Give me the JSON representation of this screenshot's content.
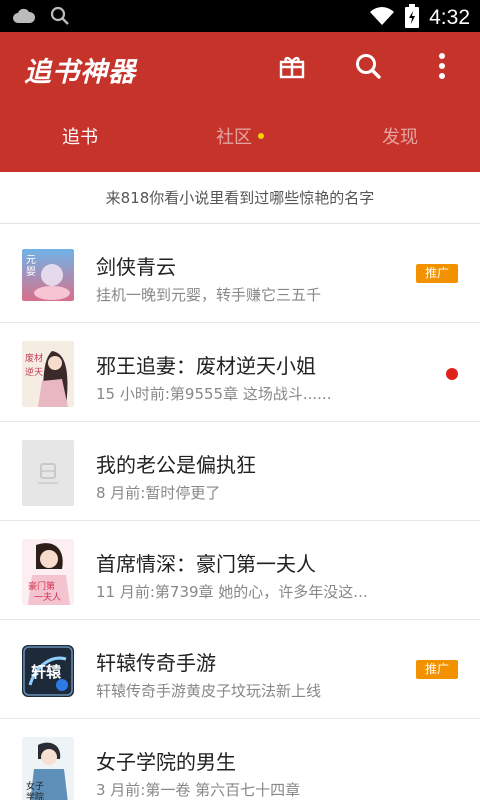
{
  "status_bar": {
    "time": "4:32",
    "icons": [
      "cloud-icon",
      "search-icon",
      "wifi-icon",
      "battery-icon"
    ]
  },
  "header": {
    "app_title": "追书神器",
    "icons": [
      "gift-icon",
      "search-icon",
      "more-vert-icon"
    ],
    "tabs": [
      {
        "label": "追书",
        "active": true
      },
      {
        "label": "社区",
        "active": false,
        "has_dot": true
      },
      {
        "label": "发现",
        "active": false
      }
    ],
    "accent_color": "#c5332b"
  },
  "notice": {
    "text": "来818你看小说里看到过哪些惊艳的名字"
  },
  "books": [
    {
      "title": "剑侠青云",
      "subtitle": "挂机一晚到元婴，转手赚它三五千",
      "badge": "推广",
      "cover_text": "元婴"
    },
    {
      "title": "邪王追妻：废材逆天小姐",
      "subtitle": "15 小时前:第9555章 这场战斗......",
      "unread": true,
      "cover_text": "废材逆天"
    },
    {
      "title": "我的老公是偏执狂",
      "subtitle": "8 月前:暂时停更了"
    },
    {
      "title": "首席情深：豪门第一夫人",
      "subtitle": "11 月前:第739章 她的心，许多年没这...",
      "cover_text": "豪门第一夫人"
    },
    {
      "title": "轩辕传奇手游",
      "subtitle": "轩辕传奇手游黄皮子坟玩法新上线",
      "badge": "推广",
      "cover_text": "轩辕"
    },
    {
      "title": "女子学院的男生",
      "subtitle": "3 月前:第一卷 第六百七十四章",
      "cover_text": "女子学院"
    }
  ]
}
